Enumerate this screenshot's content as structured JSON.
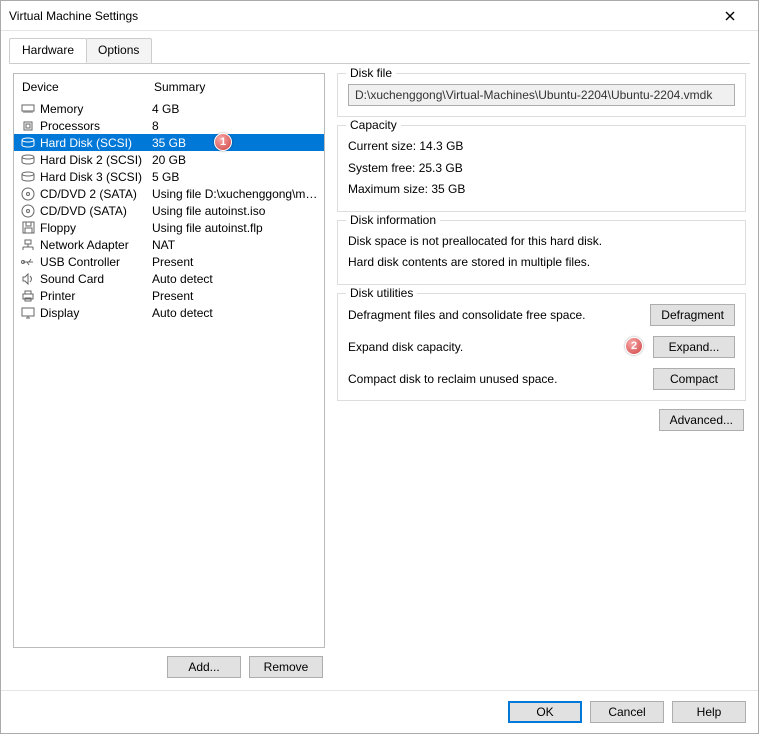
{
  "window": {
    "title": "Virtual Machine Settings"
  },
  "tabs": {
    "hardware": "Hardware",
    "options": "Options"
  },
  "columns": {
    "device": "Device",
    "summary": "Summary"
  },
  "devices": [
    {
      "name": "Memory",
      "summary": "4 GB",
      "icon": "memory-icon",
      "selected": false
    },
    {
      "name": "Processors",
      "summary": "8",
      "icon": "cpu-icon",
      "selected": false
    },
    {
      "name": "Hard Disk (SCSI)",
      "summary": "35 GB",
      "icon": "disk-icon",
      "selected": true
    },
    {
      "name": "Hard Disk 2 (SCSI)",
      "summary": "20 GB",
      "icon": "disk-icon",
      "selected": false
    },
    {
      "name": "Hard Disk 3 (SCSI)",
      "summary": "5 GB",
      "icon": "disk-icon",
      "selected": false
    },
    {
      "name": "CD/DVD 2 (SATA)",
      "summary": "Using file D:\\xuchenggong\\ma...",
      "icon": "cd-icon",
      "selected": false
    },
    {
      "name": "CD/DVD (SATA)",
      "summary": "Using file autoinst.iso",
      "icon": "cd-icon",
      "selected": false
    },
    {
      "name": "Floppy",
      "summary": "Using file autoinst.flp",
      "icon": "floppy-icon",
      "selected": false
    },
    {
      "name": "Network Adapter",
      "summary": "NAT",
      "icon": "network-icon",
      "selected": false
    },
    {
      "name": "USB Controller",
      "summary": "Present",
      "icon": "usb-icon",
      "selected": false
    },
    {
      "name": "Sound Card",
      "summary": "Auto detect",
      "icon": "sound-icon",
      "selected": false
    },
    {
      "name": "Printer",
      "summary": "Present",
      "icon": "printer-icon",
      "selected": false
    },
    {
      "name": "Display",
      "summary": "Auto detect",
      "icon": "display-icon",
      "selected": false
    }
  ],
  "left_buttons": {
    "add": "Add...",
    "remove": "Remove"
  },
  "disk_file": {
    "title": "Disk file",
    "value": "D:\\xuchenggong\\Virtual-Machines\\Ubuntu-2204\\Ubuntu-2204.vmdk"
  },
  "capacity": {
    "title": "Capacity",
    "current_label": "Current size:",
    "current_value": "14.3 GB",
    "free_label": "System free:",
    "free_value": "25.3 GB",
    "max_label": "Maximum size:",
    "max_value": "35 GB"
  },
  "disk_info": {
    "title": "Disk information",
    "line1": "Disk space is not preallocated for this hard disk.",
    "line2": "Hard disk contents are stored in multiple files."
  },
  "utilities": {
    "title": "Disk utilities",
    "defrag_text": "Defragment files and consolidate free space.",
    "defrag_btn": "Defragment",
    "expand_text": "Expand disk capacity.",
    "expand_btn": "Expand...",
    "compact_text": "Compact disk to reclaim unused space.",
    "compact_btn": "Compact"
  },
  "advanced_btn": "Advanced...",
  "footer": {
    "ok": "OK",
    "cancel": "Cancel",
    "help": "Help"
  },
  "annotations": {
    "badge1": "1",
    "badge2": "2"
  }
}
